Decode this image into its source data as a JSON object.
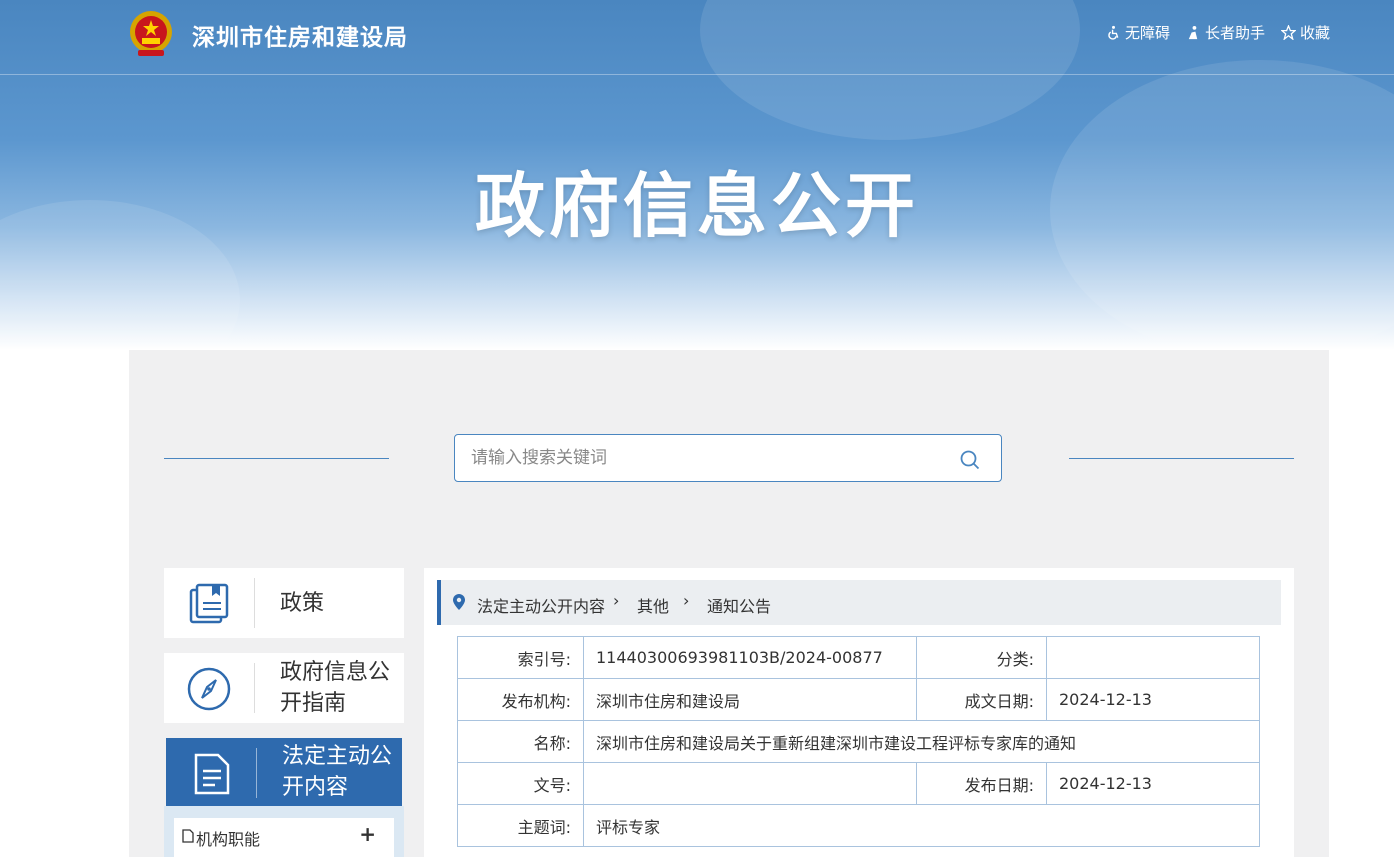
{
  "header": {
    "site_title": "深圳市住房和建设局",
    "links": [
      {
        "label": "无障碍",
        "icon": "wheelchair-icon"
      },
      {
        "label": "长者助手",
        "icon": "elder-icon"
      },
      {
        "label": "收藏",
        "icon": "star-icon"
      }
    ]
  },
  "hero": {
    "title": "政府信息公开"
  },
  "search": {
    "placeholder": "请输入搜索关键词"
  },
  "sidebar": {
    "items": [
      {
        "label": "政策",
        "icon": "book-icon",
        "active": false
      },
      {
        "label": "政府信息公开指南",
        "icon": "compass-icon",
        "active": false
      },
      {
        "label": "法定主动公开内容",
        "icon": "document-icon",
        "active": true
      }
    ],
    "sub_items": [
      {
        "label": "机构职能",
        "toggle": "+"
      }
    ]
  },
  "breadcrumb": [
    "法定主动公开内容",
    "其他",
    "通知公告"
  ],
  "meta": {
    "index_no_label": "索引号:",
    "index_no": "11440300693981103B/2024-00877",
    "category_label": "分类:",
    "category": "",
    "publisher_label": "发布机构:",
    "publisher": "深圳市住房和建设局",
    "written_date_label": "成文日期:",
    "written_date": "2024-12-13",
    "name_label": "名称:",
    "name": "深圳市住房和建设局关于重新组建深圳市建设工程评标专家库的通知",
    "doc_no_label": "文号:",
    "doc_no": "",
    "publish_date_label": "发布日期:",
    "publish_date": "2024-12-13",
    "keywords_label": "主题词:",
    "keywords": "评标专家"
  },
  "colors": {
    "primary": "#2e6aae",
    "banner": "#5c97cf",
    "panel_bg": "#f0f0f1",
    "table_border": "#a9c3de"
  }
}
